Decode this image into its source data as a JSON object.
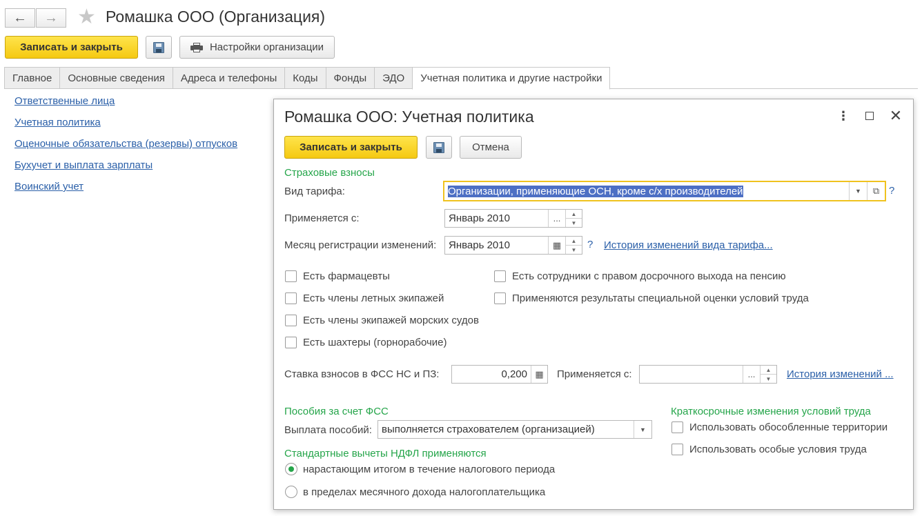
{
  "window": {
    "title": "Ромашка ООО (Организация)",
    "back_icon": "arrow-left-icon",
    "forward_icon": "arrow-right-icon",
    "favorite_icon": "star-icon"
  },
  "toolbar": {
    "save_close_label": "Записать и закрыть",
    "org_settings_label": "Настройки организации"
  },
  "tabs": [
    {
      "label": "Главное"
    },
    {
      "label": "Основные сведения"
    },
    {
      "label": "Адреса и телефоны"
    },
    {
      "label": "Коды"
    },
    {
      "label": "Фонды"
    },
    {
      "label": "ЭДО"
    },
    {
      "label": "Учетная политика и другие настройки"
    }
  ],
  "left_links": [
    {
      "label": "Ответственные лица"
    },
    {
      "label": "Учетная политика"
    },
    {
      "label": "Оценочные обязательства (резервы) отпусков"
    },
    {
      "label": "Бухучет и выплата зарплаты"
    },
    {
      "label": "Воинский учет"
    }
  ],
  "dialog": {
    "title": "Ромашка ООО: Учетная политика",
    "save_close_label": "Записать и закрыть",
    "cancel_label": "Отмена",
    "insurance_section": "Страховые взносы",
    "tariff_label": "Вид тарифа:",
    "tariff_value": "Организации, применяющие ОСН, кроме с/х производителей",
    "applies_from_label": "Применяется с:",
    "applies_from_value": "Январь 2010",
    "reg_month_label": "Месяц регистрации изменений:",
    "reg_month_value": "Январь 2010",
    "question_mark": "?",
    "tariff_history_link": "История изменений вида тарифа...",
    "checkboxes_left": [
      {
        "label": "Есть фармацевты",
        "checked": false
      },
      {
        "label": "Есть члены летных экипажей",
        "checked": false
      },
      {
        "label": "Есть члены экипажей морских судов",
        "checked": false
      },
      {
        "label": "Есть шахтеры (горнорабочие)",
        "checked": false
      }
    ],
    "checkboxes_right": [
      {
        "label": "Есть сотрудники с правом досрочного выхода на пенсию",
        "checked": false
      },
      {
        "label": "Применяются результаты специальной оценки условий труда",
        "checked": false
      }
    ],
    "fss_rate_label": "Ставка взносов в ФСС НС и ПЗ:",
    "fss_rate_value": "0,200",
    "fss_applies_label": "Применяется с:",
    "fss_applies_value": "",
    "fss_history_link": "История изменений ...",
    "benefits_section": "Пособия за счет ФСС",
    "benefits_label": "Выплата пособий:",
    "benefits_value": "выполняется страхователем (организацией)",
    "ndfl_section": "Стандартные вычеты НДФЛ применяются",
    "radio_options": [
      {
        "label": "нарастающим итогом в течение налогового периода",
        "selected": true
      },
      {
        "label": "в пределах месячного дохода налогоплательщика",
        "selected": false
      }
    ],
    "short_term_section": "Краткосрочные изменения условий труда",
    "short_term_options": [
      {
        "label": "Использовать обособленные территории",
        "checked": false
      },
      {
        "label": "Использовать особые условия труда",
        "checked": false
      }
    ],
    "more_icon": "more-vertical-icon",
    "maximize_icon": "maximize-icon",
    "close_icon": "close-icon"
  },
  "colors": {
    "accent_yellow": "#f5c912",
    "section_green": "#25a54a",
    "link_blue": "#2a5fa8",
    "selection_blue": "#4d6fc4"
  }
}
